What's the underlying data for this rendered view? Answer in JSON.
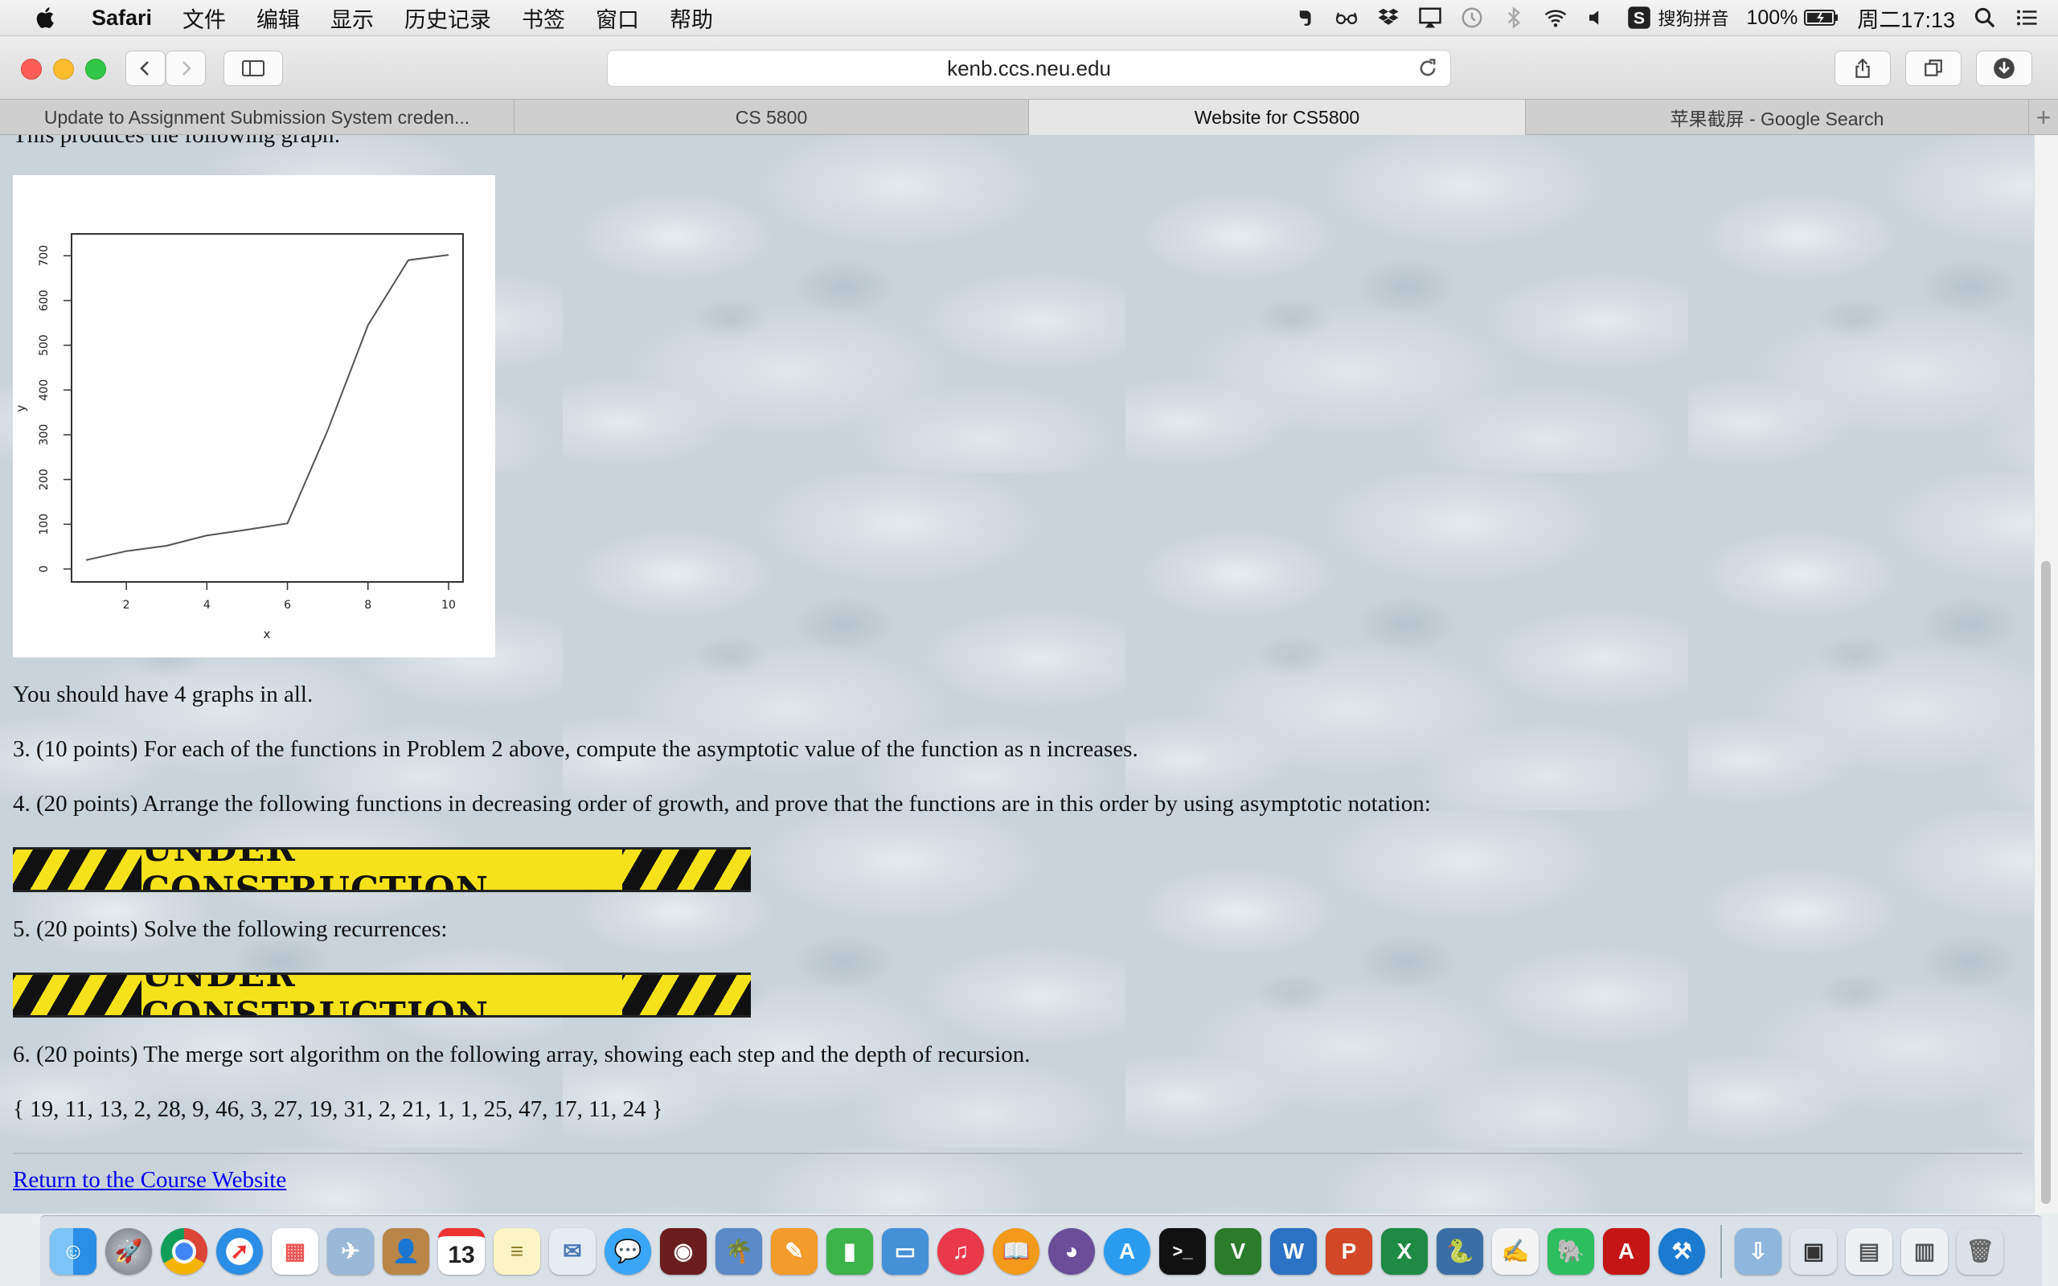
{
  "menubar": {
    "app_name": "Safari",
    "items": [
      "文件",
      "编辑",
      "显示",
      "历史记录",
      "书签",
      "窗口",
      "帮助"
    ],
    "input_method": "搜狗拼音",
    "battery": "100%",
    "clock": "周二17:13"
  },
  "browser": {
    "url": "kenb.ccs.neu.edu",
    "tabs": [
      {
        "label": "Update to Assignment Submission System creden...",
        "active": false
      },
      {
        "label": "CS 5800",
        "active": false
      },
      {
        "label": "Website for CS5800",
        "active": true
      },
      {
        "label": "苹果截屏 - Google Search",
        "active": false
      }
    ],
    "new_tab": "+"
  },
  "page": {
    "cut_heading": "This produces the following graph:",
    "after_graph": "You should have 4 graphs in all.",
    "problem3": "3. (10 points) For each of the functions in Problem 2 above, compute the asymptotic value of the function as n increases.",
    "problem4": "4. (20 points) Arrange the following functions in decreasing order of growth, and prove that the functions are in this order by using asymptotic notation:",
    "banner_text": "UNDER CONSTRUCTION",
    "problem5": "5. (20 points) Solve the following recurrences:",
    "problem6": "6. (20 points) The merge sort algorithm on the following array, showing each step and the depth of recursion.",
    "array": "{ 19, 11, 13, 2, 28, 9, 46, 3, 27, 19, 31, 2, 21, 1, 1, 25, 47, 17, 11, 24 }",
    "return_link": "Return to the Course Website"
  },
  "chart_data": {
    "type": "line",
    "xlabel": "x",
    "ylabel": "y",
    "xlim": [
      1,
      10
    ],
    "ylim": [
      0,
      720
    ],
    "xticks": [
      2,
      4,
      6,
      8,
      10
    ],
    "yticks": [
      0,
      100,
      200,
      300,
      400,
      500,
      600,
      700
    ],
    "x": [
      1,
      2,
      3,
      4,
      5,
      6,
      7,
      8,
      9,
      10
    ],
    "y": [
      20,
      40,
      52,
      75,
      88,
      102,
      310,
      545,
      690,
      702
    ],
    "line_color": "#555555"
  },
  "dock": {
    "icons": [
      "finder-icon",
      "launchpad-icon",
      "chrome-icon",
      "safari-icon",
      "grid-icon",
      "preview-icon",
      "contacts-icon",
      "calendar-icon",
      "notes-icon",
      "mail-icon",
      "messages-icon",
      "photo-booth-icon",
      "iphoto-icon",
      "pages-icon",
      "numbers-icon",
      "keynote-icon",
      "itunes-icon",
      "ibooks-icon",
      "github-icon",
      "app-store-icon",
      "terminal-icon",
      "vim-icon",
      "word-icon",
      "powerpoint-icon",
      "excel-icon",
      "python-icon",
      "textedit-icon",
      "evernote-icon",
      "acrobat-icon",
      "xcode-icon",
      "downloads-folder-icon",
      "screenshot-icon",
      "window-icon",
      "window2-icon",
      "trash-icon"
    ],
    "calendar_day": "13"
  }
}
